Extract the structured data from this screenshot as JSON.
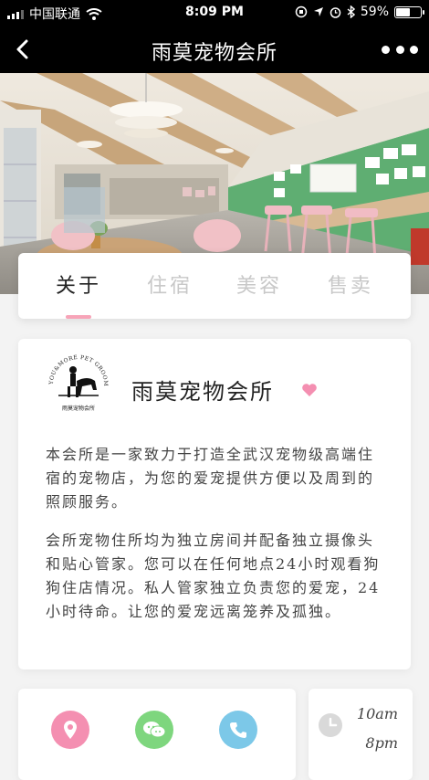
{
  "status_bar": {
    "carrier": "中国联通",
    "time": "8:09 PM",
    "battery_percent": "59%",
    "battery_level": 0.59
  },
  "nav": {
    "title": "雨莫宠物会所",
    "back_icon": "chevron-left-icon",
    "more_icon": "more-dots-icon"
  },
  "tabs": [
    {
      "label": "关于",
      "active": true
    },
    {
      "label": "住宿",
      "active": false
    },
    {
      "label": "美容",
      "active": false
    },
    {
      "label": "售卖",
      "active": false
    }
  ],
  "info": {
    "logo_text_arc": "YOU&MORE PET GROOMING STUDIO",
    "logo_caption": "雨莫宠物会所",
    "shop_name": "雨莫宠物会所",
    "paragraph_1": "本会所是一家致力于打造全武汉宠物级高端住宿的宠物店，为您的爱宠提供方便以及周到的照顾服务。",
    "paragraph_2": "会所宠物住所均为独立房间并配备独立摄像头和贴心管家。您可以在任何地点24小时观看狗狗住店情况。私人管家独立负责您的爱宠，24小时待命。让您的爱宠远离笼养及孤独。"
  },
  "contact": {
    "location_icon": "location-pin-icon",
    "wechat_icon": "wechat-icon",
    "phone_icon": "phone-icon"
  },
  "hours": {
    "open": "10am",
    "close": "8pm"
  },
  "colors": {
    "accent_pink": "#f7a4b8",
    "location": "#f48fb1",
    "wechat": "#7ed67e",
    "phone": "#7cc8e8"
  }
}
